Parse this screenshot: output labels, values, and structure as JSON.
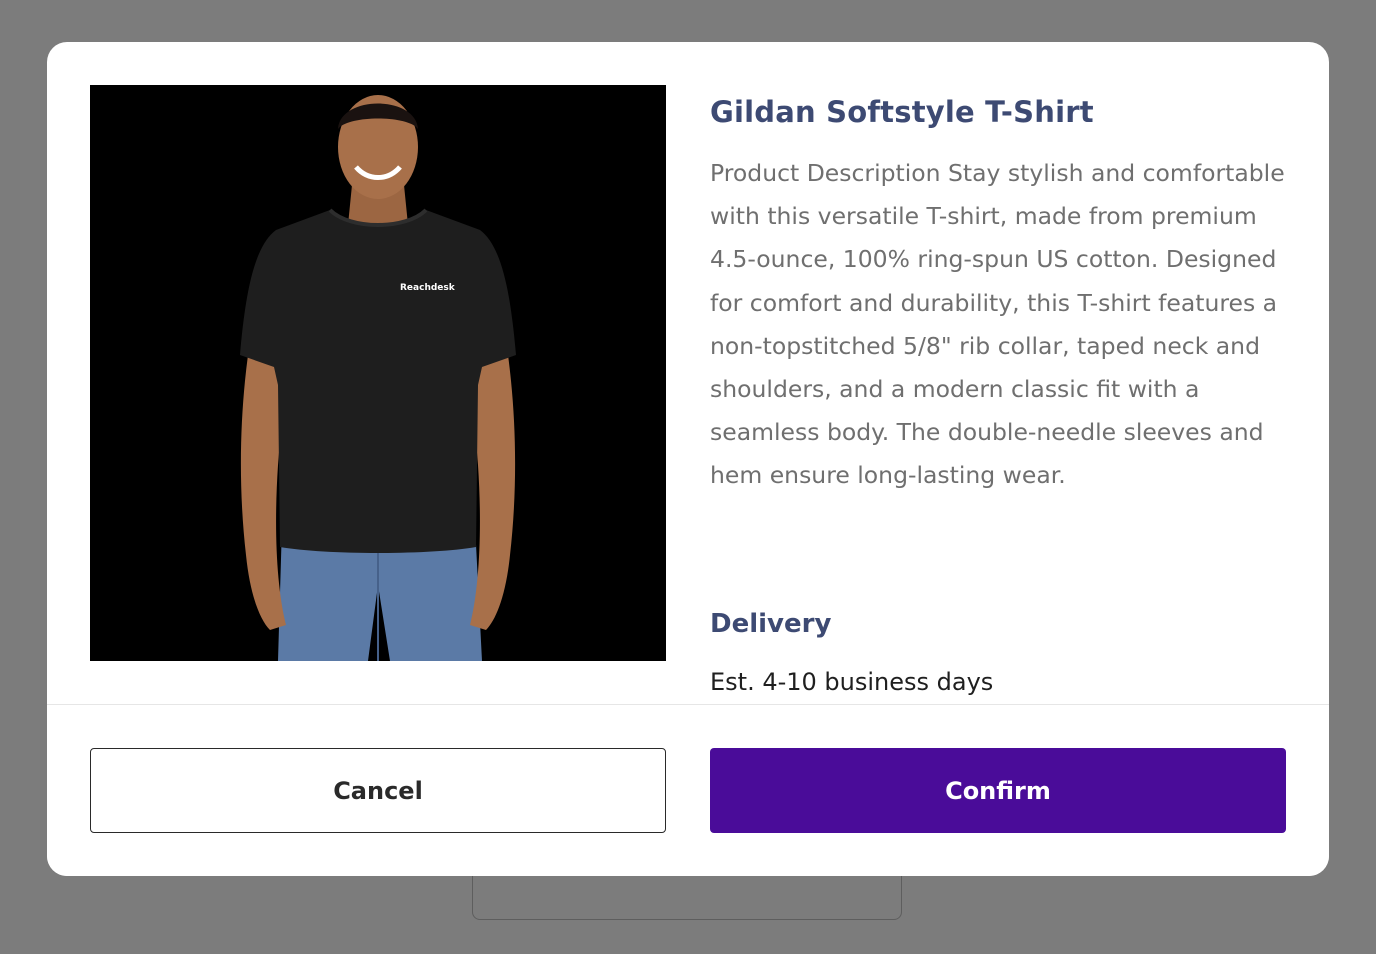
{
  "modal": {
    "product": {
      "title": "Gildan Softstyle T-Shirt",
      "description": "Product Description Stay stylish and comfortable with this versatile T-shirt, made from premium 4.5-ounce, 100% ring-spun US cotton. Designed for comfort and durability, this T-shirt features a non-topstitched 5/8\" rib collar, taped neck and shoulders, and a modern classic fit with a seamless body. The double-needle sleeves and hem ensure long-lasting wear.",
      "image_logo_text": "Reachdesk"
    },
    "delivery": {
      "heading": "Delivery",
      "estimate": "Est. 4-10 business days"
    },
    "actions": {
      "cancel_label": "Cancel",
      "confirm_label": "Confirm"
    }
  },
  "colors": {
    "backdrop": "#7c7c7c",
    "heading": "#3d4a73",
    "body_text": "#6f6f6f",
    "confirm_button": "#4a0c99"
  }
}
